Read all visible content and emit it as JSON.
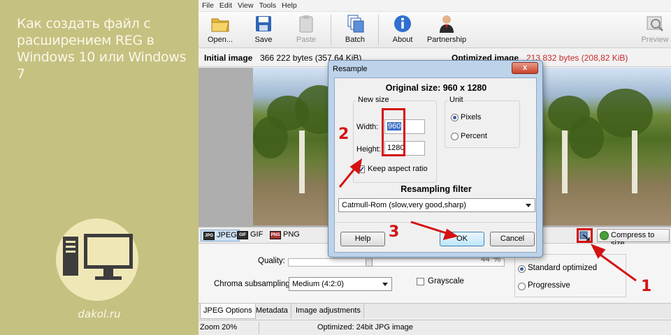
{
  "banner": {
    "title": "Как создать файл с расширением REG в Windows 10 или Windows 7",
    "site": "dakol.ru"
  },
  "menu": [
    "File",
    "Edit",
    "View",
    "Tools",
    "Help"
  ],
  "toolbar": {
    "open": "Open...",
    "save": "Save",
    "paste": "Paste",
    "batch": "Batch",
    "about": "About",
    "partnership": "Partnership",
    "preview": "Preview"
  },
  "info": {
    "initial_label": "Initial image",
    "initial_value": "366 222 bytes (357,64 KiB)",
    "optimized_label": "Optimized image",
    "optimized_value": "213 832 bytes (208,82 KiB)"
  },
  "formats": [
    "JPEG",
    "GIF",
    "PNG"
  ],
  "compress_label": "Compress to size",
  "options": {
    "quality_label": "Quality:",
    "quality_value": "44",
    "quality_unit": "%",
    "chroma_label": "Chroma subsampling:",
    "chroma_value": "Medium (4:2:0)",
    "grayscale_label": "Grayscale",
    "standard_label": "Standard optimized",
    "progressive_label": "Progressive"
  },
  "bottom_tabs": [
    "JPEG Options",
    "Metadata",
    "Image adjustments"
  ],
  "status": {
    "zoom": "Zoom 20%",
    "type": "Optimized: 24bit JPG image"
  },
  "dialog": {
    "title": "Resample",
    "close": "x",
    "original_size": "Original size: 960 x 1280",
    "new_size_legend": "New size",
    "width_label": "Width:",
    "width_value": "960",
    "height_label": "Height:",
    "height_value": "1280",
    "keep_aspect": "Keep aspect ratio",
    "unit_legend": "Unit",
    "pixels": "Pixels",
    "percent": "Percent",
    "filter_label": "Resampling filter",
    "filter_value": "Catmull-Rom (slow,very good,sharp)",
    "help": "Help",
    "ok": "OK",
    "cancel": "Cancel"
  },
  "annotations": [
    "1",
    "2",
    "3"
  ],
  "colors": {
    "banner_bg": "#c5c181",
    "annotation_red": "#d41313",
    "dialog_frame": "#bdd3ea"
  }
}
